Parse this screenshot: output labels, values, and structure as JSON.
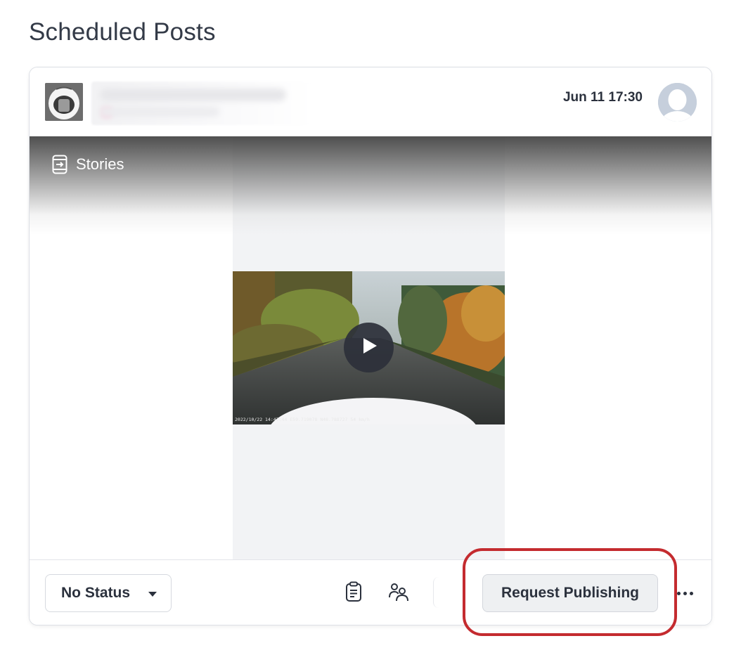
{
  "page": {
    "title": "Scheduled Posts"
  },
  "post": {
    "scheduled_time": "Jun 11 17:30",
    "type_label": "Stories",
    "video": {
      "timestamp_overlay": "2022/10/22 14:47:44  E59.719078 N48.788727 54 km/h"
    }
  },
  "footer": {
    "status_label": "No Status",
    "request_button_label": "Request Publishing"
  },
  "icons": {
    "notes": "clipboard-icon",
    "assign": "people-icon",
    "more": "more-dots-icon",
    "play": "play-icon",
    "stories": "stories-icon"
  },
  "colors": {
    "highlight": "#c42b2f",
    "text": "#2b313d",
    "media_bg": "#f2f3f5"
  }
}
